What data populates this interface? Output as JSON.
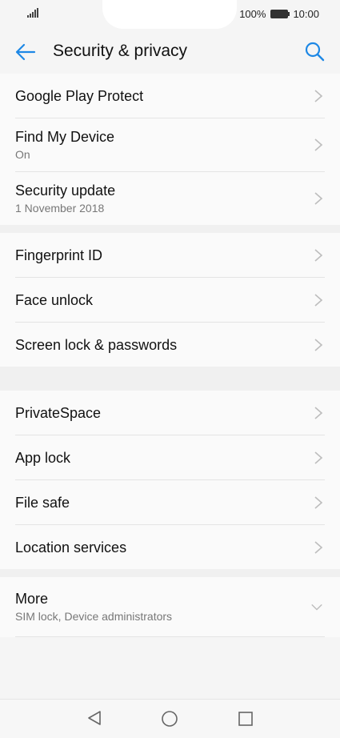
{
  "status": {
    "battery": "100%",
    "time": "10:00"
  },
  "header": {
    "title": "Security & privacy"
  },
  "groups": [
    [
      {
        "label": "Google Play Protect"
      },
      {
        "label": "Find My Device",
        "sub": "On"
      },
      {
        "label": "Security update",
        "sub": "1 November 2018"
      }
    ],
    [
      {
        "label": "Fingerprint ID"
      },
      {
        "label": "Face unlock"
      },
      {
        "label": "Screen lock & passwords"
      }
    ],
    [
      {
        "label": "PrivateSpace"
      },
      {
        "label": "App lock"
      },
      {
        "label": "File safe"
      },
      {
        "label": "Location services"
      }
    ],
    [
      {
        "label": "More",
        "sub": "SIM lock, Device administrators"
      }
    ]
  ],
  "colors": {
    "accent": "#1e88e5",
    "chevron": "#bdbdbd"
  }
}
